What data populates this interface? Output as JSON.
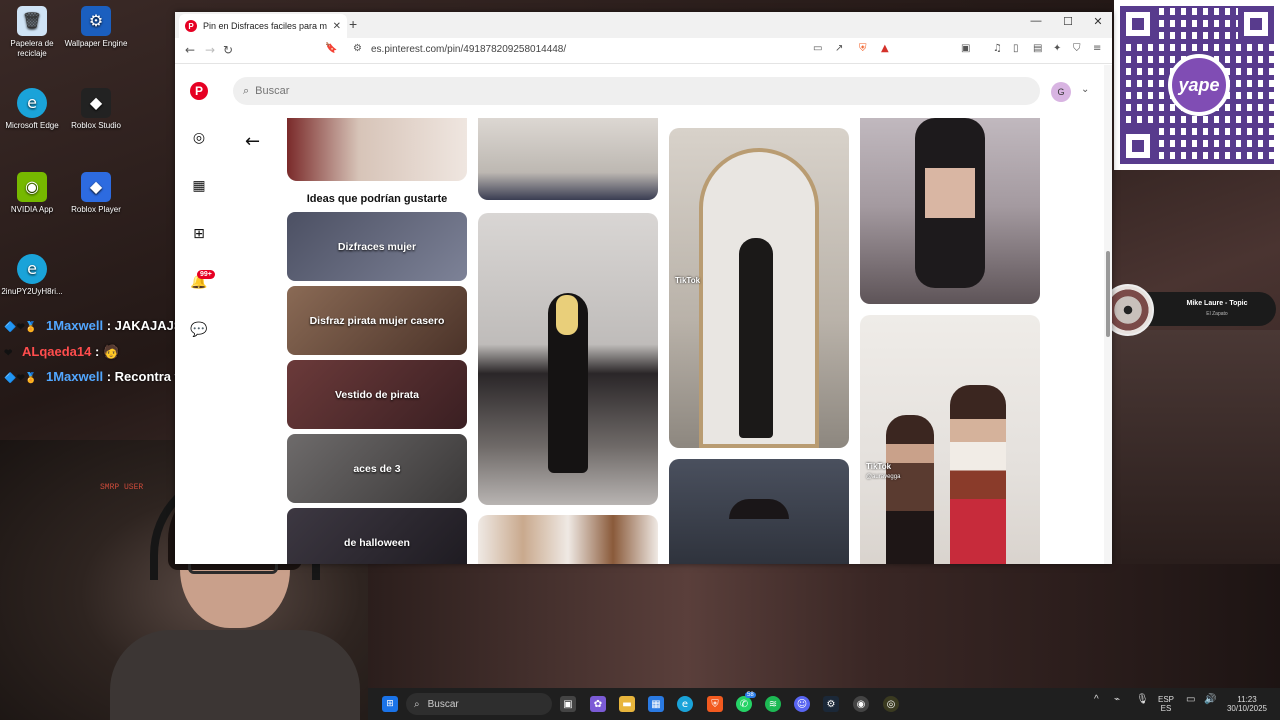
{
  "desktop": {
    "icons": [
      {
        "label": "Papelera de reciclaje",
        "icon": "recycle-bin-icon",
        "glyph": "🗑",
        "color": "#cfe3f5"
      },
      {
        "label": "Wallpaper Engine",
        "icon": "wallpaper-engine-icon",
        "glyph": "⚙",
        "color": "#1b5fbf"
      },
      {
        "label": "Microsoft Edge",
        "icon": "edge-icon",
        "glyph": "e",
        "color": "#1aa3d9"
      },
      {
        "label": "Roblox Studio",
        "icon": "roblox-studio-icon",
        "glyph": "◆",
        "color": "#222222"
      },
      {
        "label": "NVIDIA App",
        "icon": "nvidia-icon",
        "glyph": "◉",
        "color": "#76b900"
      },
      {
        "label": "Roblox Player",
        "icon": "roblox-player-icon",
        "glyph": "◆",
        "color": "#2d6be0"
      },
      {
        "label": "2inuPY2UyH8ri...",
        "icon": "edge-shortcut-icon",
        "glyph": "e",
        "color": "#1aa3d9"
      }
    ]
  },
  "chat": [
    {
      "user": "1Maxwell",
      "sep": " : ",
      "message": "JAKAJAJSAJA",
      "user_color": "#52a7ff"
    },
    {
      "user": "ALqaeda14",
      "sep": " : ",
      "message": "🧑",
      "user_color": "#ff4d4d"
    },
    {
      "user": "1Maxwell",
      "sep": " : ",
      "message": "Recontra wn",
      "user_color": "#52a7ff"
    }
  ],
  "webcam": {
    "overlay_text": "SMRP USER"
  },
  "qr": {
    "logo_text": "yape"
  },
  "now_playing": {
    "title": "Mike Laure - Topic",
    "artist": "El Zapato"
  },
  "browser": {
    "tab_title": "Pin en Disfraces faciles para muj",
    "tab_favicon": "P",
    "new_tab": "+",
    "window_controls": {
      "minimize": "—",
      "maximize": "☐",
      "close": "✕"
    },
    "nav": {
      "back": "←",
      "forward": "→",
      "reload": "↻",
      "bookmark": "🔖",
      "site_info": "⚙"
    },
    "url": "es.pinterest.com/pin/491878209258014448/",
    "shield_count": "2"
  },
  "pinterest": {
    "logo": "P",
    "search_placeholder": "Buscar",
    "avatar_initial": "G",
    "notifications_badge": "99+",
    "ideas_title": "Ideas que podrían gustarte",
    "ideas": [
      {
        "label": "Dizfraces mujer",
        "color": "#5a5f72"
      },
      {
        "label": "Disfraz pirata mujer casero",
        "color": "#6b4b3e"
      },
      {
        "label": "Vestido de pirata",
        "color": "#5b3838"
      },
      {
        "label": "aces de 3",
        "color": "#4b4949"
      },
      {
        "label": "de halloween",
        "color": "#2f2b33"
      }
    ],
    "tiktok_label": "TikTok",
    "tiktok_handle": "@auravegga"
  },
  "taskbar": {
    "search_placeholder": "Buscar",
    "language": "ESP",
    "region": "ES",
    "time": "11:23",
    "date": "30/10/2025",
    "discord_badge": "58"
  },
  "colors": {
    "pinterest_red": "#e60023",
    "accent": "#3b1a7a"
  }
}
